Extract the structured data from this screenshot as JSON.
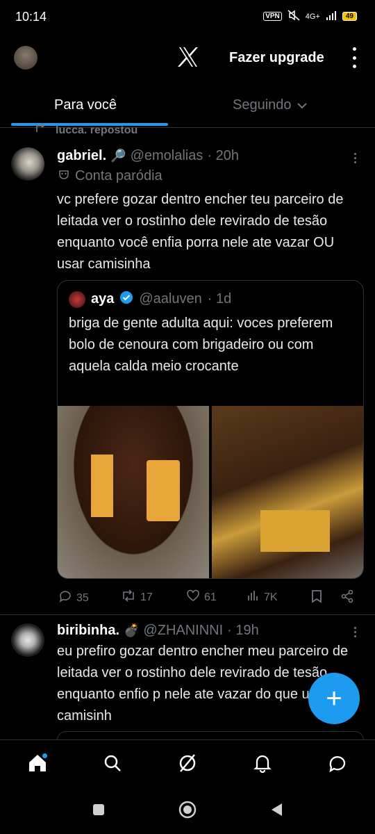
{
  "status_bar": {
    "time": "10:14",
    "vpn": "VPN",
    "network": "4G+",
    "battery": "49"
  },
  "header": {
    "upgrade_label": "Fazer upgrade"
  },
  "tabs": [
    {
      "label": "Para você"
    },
    {
      "label": "Seguindo"
    }
  ],
  "repost_label": "lucca. repostou",
  "tweet1": {
    "name": "gabriel.",
    "name_emoji": "🔎",
    "handle": "@emolalias",
    "time": "· 20h",
    "parody_label": "Conta paródia",
    "text": "vc prefere gozar dentro encher teu parceiro de leitada ver o rostinho dele revirado de tesão enquanto você enfia porra nele ate vazar OU usar camisinha",
    "quote": {
      "name": "aya",
      "handle": "@aaluven",
      "time": "· 1d",
      "text": "briga de gente adulta aqui: voces preferem bolo de cenoura com brigadeiro ou com aquela calda meio crocante"
    },
    "actions": {
      "replies": "35",
      "reposts": "17",
      "likes": "61",
      "views": "7K"
    }
  },
  "tweet2": {
    "name": "biribinha.",
    "name_emoji": "💣",
    "handle": "@ZHANINNI",
    "time": "· 19h",
    "text": "eu prefiro gozar dentro encher meu parceiro de leitada ver o rostinho dele revirado de tesão enquanto enfio p nele ate vazar do que usar camisinh"
  },
  "fab_symbol": "+",
  "colors": {
    "accent": "#1d9bf0",
    "background": "#000000",
    "muted": "#71767b",
    "text": "#e7e9ea"
  }
}
